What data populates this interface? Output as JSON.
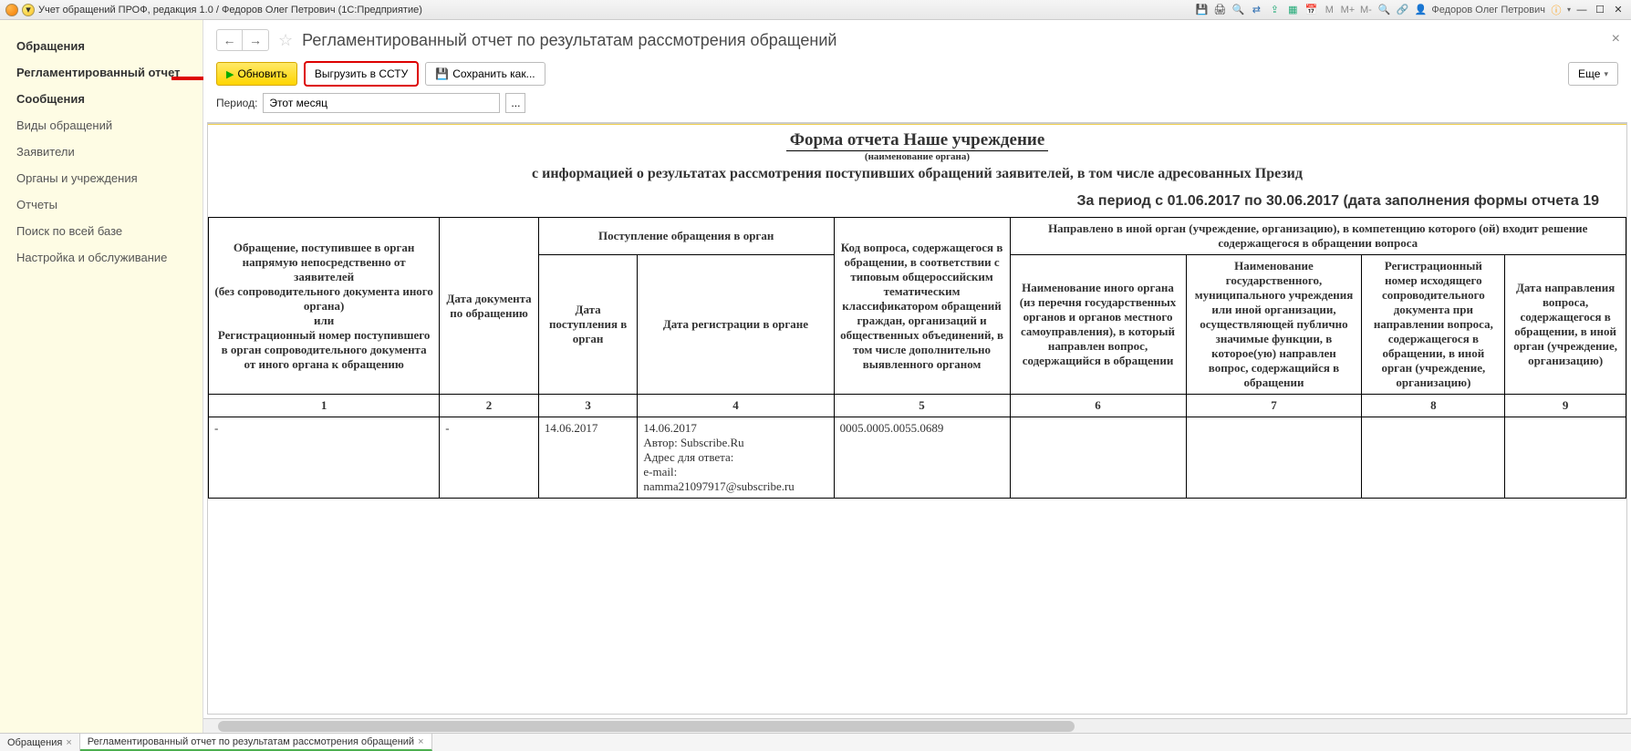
{
  "titlebar": {
    "title": "Учет обращений ПРОФ, редакция 1.0 / Федоров Олег Петрович  (1С:Предприятие)",
    "user": "Федоров Олег Петрович",
    "m_labels": [
      "M",
      "M+",
      "M-"
    ]
  },
  "sidebar": {
    "items": [
      {
        "label": "Обращения",
        "strong": true
      },
      {
        "label": "Регламентированный отчет",
        "strong": true
      },
      {
        "label": "Сообщения",
        "strong": true
      },
      {
        "label": "Виды обращений"
      },
      {
        "label": "Заявители"
      },
      {
        "label": "Органы и учреждения"
      },
      {
        "label": "Отчеты"
      },
      {
        "label": "Поиск по всей базе"
      },
      {
        "label": "Настройка и обслуживание"
      }
    ]
  },
  "page": {
    "title": "Регламентированный отчет по результатам рассмотрения обращений"
  },
  "toolbar": {
    "refresh": "Обновить",
    "export": "Выгрузить в ССТУ",
    "saveas": "Сохранить как...",
    "more": "Еще"
  },
  "period": {
    "label": "Период:",
    "value": "Этот месяц"
  },
  "report": {
    "title_prefix": "Форма отчета ",
    "title_org": "Наше учреждение",
    "sub_note": "(наименование органа)",
    "line2": "с информацией о результатах рассмотрения поступивших обращений заявителей, в том числе адресованных Презид",
    "line3": "За период с 01.06.2017 по 30.06.2017 (дата заполнения формы отчета 19",
    "headers": {
      "c1": "Обращение, поступившее в орган напрямую непосредственно от заявителей\n(без сопроводительного документа иного органа)\nили\nРегистрационный номер поступившего в орган сопроводительного документа от иного органа к обращению",
      "c2": "Дата документа по обращению",
      "g3_top": "Поступление обращения в орган",
      "c3": "Дата поступления в орган",
      "c4": "Дата регистрации в органе",
      "c5": "Код вопроса, содержащегося в обращении, в соответствии с типовым общероссийским тематическим классификатором обращений граждан, организаций и общественных объединений, в том числе дополнительно выявленного органом",
      "g6_top": "Направлено в иной орган (учреждение, организацию), в компетенцию которого (ой) входит решение содержащегося в обращении вопроса",
      "c6": "Наименование иного органа (из перечня государственных органов и органов местного самоуправления), в который направлен вопрос, содержащийся в обращении",
      "c7": "Наименование государственного, муниципального учреждения или иной организации, осуществляющей публично значимые функции, в которое(ую) направлен вопрос, содержащийся в обращении",
      "c8": "Регистрационный номер исходящего сопроводительного документа при направлении вопроса, содержащегося в обращении, в иной орган (учреждение, организацию)",
      "c9": "Дата направления вопроса, содержащегося в обращении, в иной орган (учреждение, организацию)"
    },
    "colnums": [
      "1",
      "2",
      "3",
      "4",
      "5",
      "6",
      "7",
      "8",
      "9"
    ],
    "row": {
      "c1": "-",
      "c2": "-",
      "c3": "14.06.2017",
      "c4": "14.06.2017\nАвтор: Subscribe.Ru\nАдрес для ответа:\ne-mail:\nnamma21097917@subscribe.ru",
      "c5": "0005.0005.0055.0689",
      "c6": "",
      "c7": "",
      "c8": "",
      "c9": ""
    }
  },
  "tabs": [
    {
      "label": "Обращения"
    },
    {
      "label": "Регламентированный отчет по результатам рассмотрения обращений",
      "active": true
    }
  ]
}
